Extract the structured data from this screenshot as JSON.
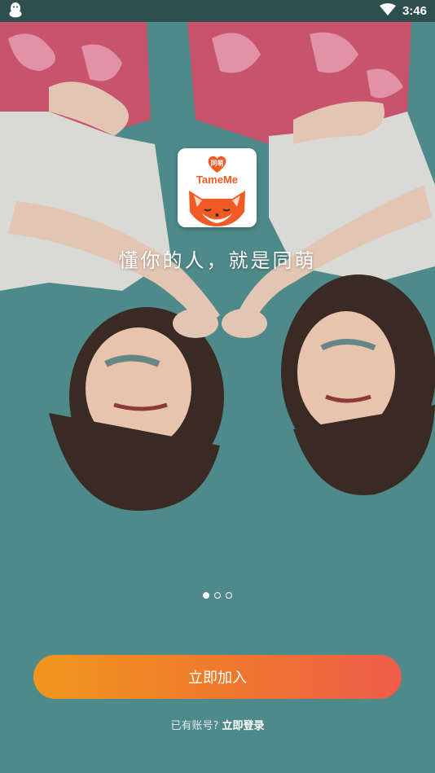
{
  "status_bar": {
    "time": "3:46",
    "notification_icon": "qq-penguin-icon",
    "signal_icon": "wifi-icon"
  },
  "logo": {
    "badge_text": "同萌",
    "brand_text": "TameMe",
    "mascot_icon": "fox-icon"
  },
  "tagline": "懂你的人，就是同萌",
  "pager": {
    "count": 3,
    "active_index": 0
  },
  "actions": {
    "join_label": "立即加入",
    "login_prompt": "已有账号?",
    "login_link": "立即登录"
  },
  "colors": {
    "background": "#4e8a89",
    "status_bar": "#2f4f4e",
    "button_start": "#f0961e",
    "button_end": "#ee5c4a",
    "brand_orange": "#f15a22"
  }
}
